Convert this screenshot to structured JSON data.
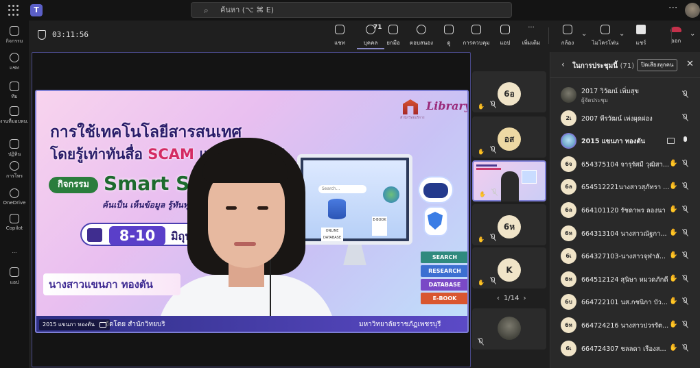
{
  "topbar": {
    "search_placeholder": "ค้นหา (⌥ ⌘ E)",
    "more": "···",
    "teams_logo": "T"
  },
  "rail": [
    {
      "label": "กิจกรรม",
      "icon": "bell-icon",
      "name": "rail-activity"
    },
    {
      "label": "แชท",
      "icon": "chat-icon",
      "name": "rail-chat"
    },
    {
      "label": "ทีม",
      "icon": "teams-icon",
      "name": "rail-teams"
    },
    {
      "label": "งานที่มอบหม...",
      "icon": "assignments-icon",
      "name": "rail-assignments"
    },
    {
      "label": "ปฏิทิน",
      "icon": "calendar-icon",
      "name": "rail-calendar"
    },
    {
      "label": "การโทร",
      "icon": "phone-icon",
      "name": "rail-calls"
    },
    {
      "label": "OneDrive",
      "icon": "cloud-icon",
      "name": "rail-onedrive"
    },
    {
      "label": "Copilot",
      "icon": "copilot-icon",
      "name": "rail-copilot"
    },
    {
      "label": "···",
      "icon": "more-icon",
      "name": "rail-more"
    },
    {
      "label": "แอป",
      "icon": "plus-icon",
      "name": "rail-apps"
    }
  ],
  "meeting": {
    "timer": "03:11:56",
    "toolbar": [
      {
        "label": "แชท",
        "icon": "chat-icon",
        "name": "chat-button"
      },
      {
        "label": "บุคคล",
        "icon": "people-icon",
        "name": "people-button",
        "count": "71"
      },
      {
        "label": "ยกมือ",
        "icon": "raise-hand-icon",
        "name": "raise-hand-button"
      },
      {
        "label": "ตอบสนอง",
        "icon": "react-icon",
        "name": "react-button"
      },
      {
        "label": "ดู",
        "icon": "view-icon",
        "name": "view-button"
      },
      {
        "label": "การควบคุม",
        "icon": "controls-icon",
        "name": "controls-button"
      },
      {
        "label": "แอป",
        "icon": "apps-icon",
        "name": "apps-button"
      },
      {
        "label": "เพิ่มเติม",
        "icon": "more-icon",
        "name": "more-button"
      },
      {
        "label": "กล้อง",
        "icon": "camera-off-icon",
        "name": "camera-button"
      },
      {
        "label": "ไมโครโฟน",
        "icon": "mic-off-icon",
        "name": "mic-button"
      },
      {
        "label": "แชร์",
        "icon": "share-icon",
        "name": "share-button"
      },
      {
        "label": "ออก",
        "icon": "leave-icon",
        "name": "leave-button"
      }
    ]
  },
  "presentation": {
    "logo": "Library",
    "logo_sub": "สำนักวิทยบริการ",
    "headline1": "การใช้เทคโนโลยีสารสนเทศ",
    "headline2_pre": "โดยรู้เท่าทันสื่อ ",
    "headline2_scam": "SCAM",
    "headline2_post": " และ STEAM",
    "activity": "กิจกรรม",
    "smart": "Smart Se",
    "tagline": "ค้นเป็น เห็นข้อมูล รู้ทันทุก",
    "date_num": "8-10",
    "date_month": "มิถุนายน",
    "presenter_banner": "นางสาวแขนภา ทองตัน",
    "footer_left": "จัดโดย สำนักวิทยบริ",
    "footer_right": "มหาวิทยาลัยราชภัฏเพชรบุรี",
    "search_hint": "Search...",
    "online_db": "ONLINE DATABASE",
    "ebook": "E-BOOK",
    "books": [
      "SEARCH",
      "RESEARCH",
      "DATABASE",
      "E-BOOK"
    ],
    "book_colors": [
      "#2f8a7e",
      "#3c6fd1",
      "#7a49c6",
      "#d9562f"
    ],
    "speaker_tag": "2015 แขนภา ทองตัน"
  },
  "tiles": [
    {
      "initials": "6อ",
      "type": "avatar"
    },
    {
      "initials": "อส",
      "type": "avatar-gold"
    },
    {
      "initials": "",
      "type": "share"
    },
    {
      "initials": "6ห",
      "type": "avatar"
    },
    {
      "initials": "K",
      "type": "avatar"
    },
    {
      "initials": "",
      "type": "photo"
    }
  ],
  "pager": {
    "text": "1/14",
    "prev": "‹",
    "next": "›"
  },
  "panel": {
    "title": "ในการประชุมนี้",
    "count": "(71)",
    "mute_all": "ปิดเสียงทุกคน",
    "participants": [
      {
        "name": "2017 วิวัฒน์ เพิ่มสุข",
        "role": "ผู้จัดประชุม",
        "avatar": "photo",
        "initials": ""
      },
      {
        "name": "2007 พีรวัฒน์ เพ่งผุดผ่อง",
        "role": "",
        "avatar": "initials",
        "initials": "2เ"
      },
      {
        "name": "2015 แขนภา ทองตัน",
        "role": "",
        "avatar": "ring",
        "initials": "",
        "presenting": true
      },
      {
        "name": "654375104 จารุรัศมี วุฒิสา...",
        "role": "",
        "avatar": "initials",
        "initials": "6จ"
      },
      {
        "name": "654512221นางสาวสุภัทรา ...",
        "role": "",
        "avatar": "initials",
        "initials": "6ล"
      },
      {
        "name": "664101120 รัชดาพร ลองนา",
        "role": "",
        "avatar": "initials",
        "initials": "6ล"
      },
      {
        "name": "664313104 นางสาวณัฐกา...",
        "role": "",
        "avatar": "initials",
        "initials": "6ห"
      },
      {
        "name": "664327103-นางสาวจุฬาลั...",
        "role": "",
        "avatar": "initials",
        "initials": "6เ"
      },
      {
        "name": "664512124 สุนิษา หมวดภักดี",
        "role": "",
        "avatar": "initials",
        "initials": "6ห"
      },
      {
        "name": "664722101 นส.กชนิกา บัว...",
        "role": "",
        "avatar": "initials",
        "initials": "6บ"
      },
      {
        "name": "664724216 นางสาวปวรรัต...",
        "role": "",
        "avatar": "initials",
        "initials": "6ห"
      },
      {
        "name": "664724307 ชลลดา เรืองส...",
        "role": "",
        "avatar": "initials",
        "initials": "6เ"
      }
    ]
  }
}
